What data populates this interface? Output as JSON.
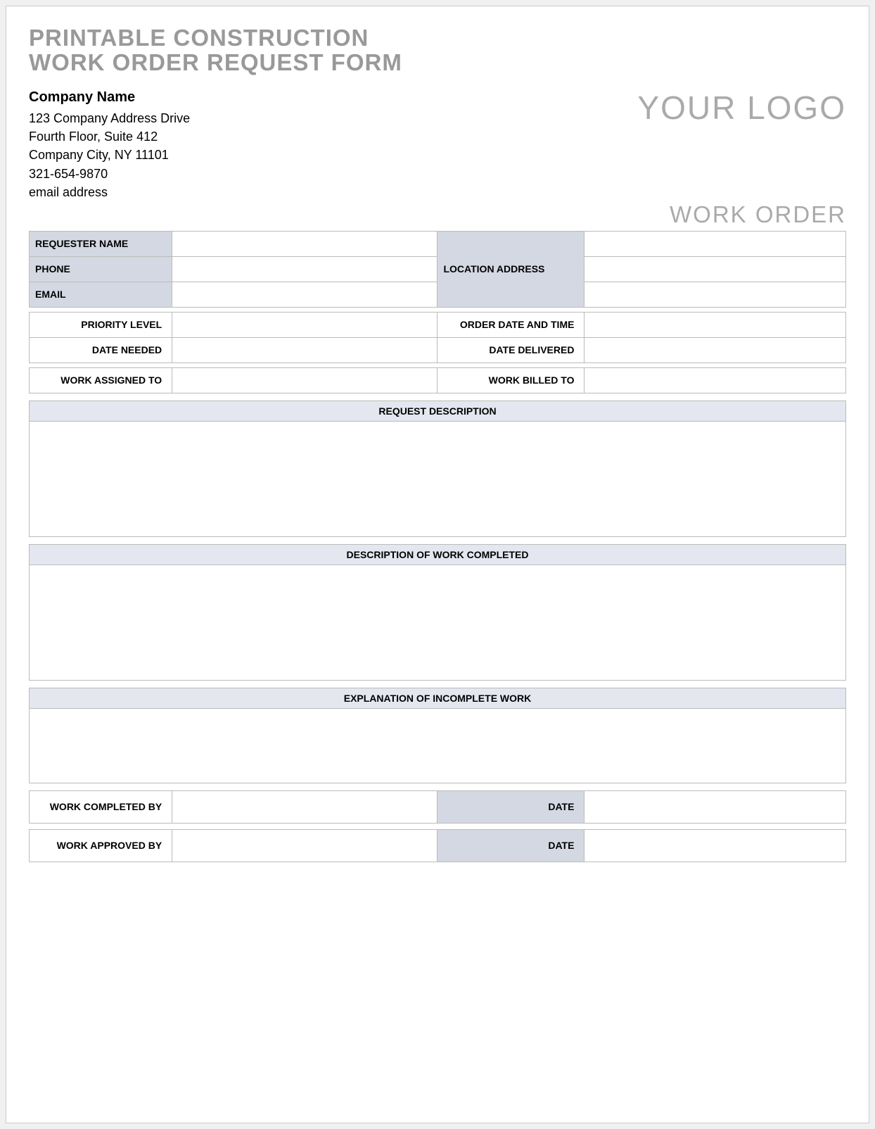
{
  "title": "PRINTABLE CONSTRUCTION\nWORK ORDER REQUEST FORM",
  "company": {
    "name": "Company Name",
    "address1": "123 Company Address Drive",
    "address2": "Fourth Floor, Suite 412",
    "city_line": "Company City, NY  11101",
    "phone": "321-654-9870",
    "email": "email address"
  },
  "logo_text": "YOUR LOGO",
  "work_order_label": "WORK ORDER",
  "fields": {
    "requester_name": "REQUESTER NAME",
    "phone": "PHONE",
    "email": "EMAIL",
    "location_address": "LOCATION ADDRESS",
    "priority_level": "PRIORITY LEVEL",
    "order_date_time": "ORDER DATE AND TIME",
    "date_needed": "DATE NEEDED",
    "date_delivered": "DATE DELIVERED",
    "work_assigned_to": "WORK ASSIGNED TO",
    "work_billed_to": "WORK BILLED TO"
  },
  "sections": {
    "request_description": "REQUEST DESCRIPTION",
    "work_completed_desc": "DESCRIPTION OF WORK COMPLETED",
    "incomplete_explanation": "EXPLANATION OF INCOMPLETE WORK"
  },
  "signoff": {
    "completed_by": "WORK COMPLETED BY",
    "approved_by": "WORK APPROVED BY",
    "date": "DATE"
  }
}
